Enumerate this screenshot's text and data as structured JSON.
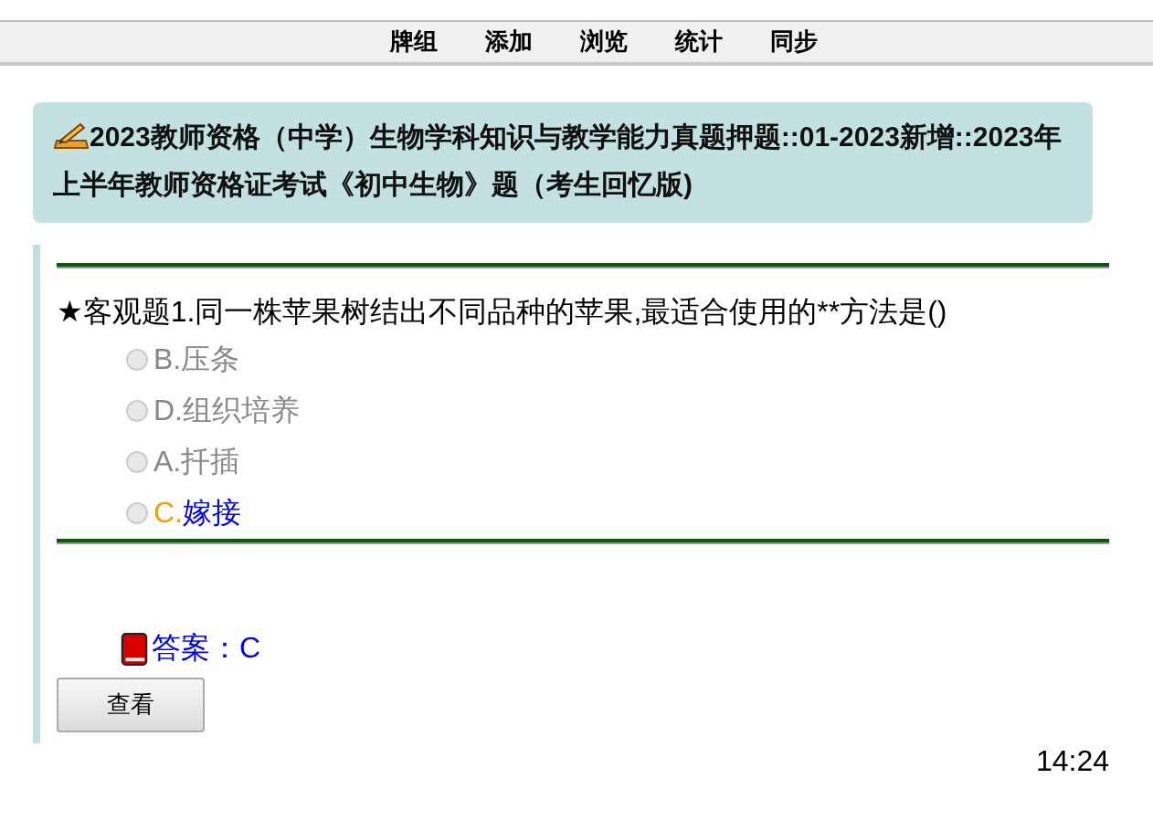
{
  "nav": [
    {
      "label": "牌组"
    },
    {
      "label": "添加"
    },
    {
      "label": "浏览"
    },
    {
      "label": "统计"
    },
    {
      "label": "同步"
    }
  ],
  "deck_title": "2023教师资格（中学）生物学科知识与教学能力真题押题::01-2023新增::2023年上半年教师资格证考试《初中生物》题（考生回忆版)",
  "question": {
    "star": "★",
    "text": "客观题1.同一株苹果树结出不同品种的苹果,最适合使用的**方法是()"
  },
  "options": [
    {
      "letter": "B.",
      "text": "压条",
      "checked": false,
      "correct": false
    },
    {
      "letter": "D.",
      "text": "组织培养",
      "checked": false,
      "correct": false
    },
    {
      "letter": "A.",
      "text": "扦插",
      "checked": false,
      "correct": false
    },
    {
      "letter": "C.",
      "text": "嫁接",
      "checked": false,
      "correct": true
    }
  ],
  "answer": "答案：C",
  "view_button": "查看",
  "time": "14:24"
}
